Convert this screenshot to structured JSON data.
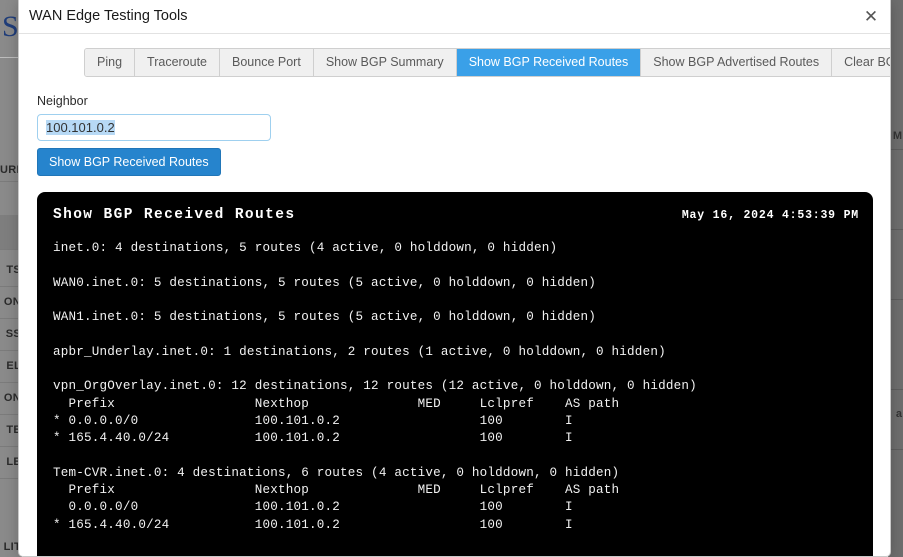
{
  "background": {
    "logo_glyph": "S",
    "sidebar_items": [
      {
        "label": "URIT"
      },
      {
        "label": ""
      },
      {
        "label": "TS"
      },
      {
        "label": "ON"
      },
      {
        "label": "SS"
      },
      {
        "label": "EL"
      },
      {
        "label": "ON"
      },
      {
        "label": "TE"
      },
      {
        "label": "LE"
      },
      {
        "label": "LIT"
      }
    ],
    "right_labels": [
      {
        "label": "M"
      },
      {
        "label": "a"
      }
    ]
  },
  "modal": {
    "title": "WAN Edge Testing Tools",
    "close_icon": "close-icon",
    "close_glyph": "✕",
    "accent_color": "#3aa0e8",
    "button_color": "#2684cd",
    "tabs": [
      {
        "label": "Ping",
        "active": false
      },
      {
        "label": "Traceroute",
        "active": false
      },
      {
        "label": "Bounce Port",
        "active": false
      },
      {
        "label": "Show BGP Summary",
        "active": false
      },
      {
        "label": "Show BGP Received Routes",
        "active": true
      },
      {
        "label": "Show BGP Advertised Routes",
        "active": false
      },
      {
        "label": "Clear BGP",
        "active": false
      }
    ],
    "form": {
      "neighbor_label": "Neighbor",
      "neighbor_value": "100.101.0.2",
      "neighbor_placeholder": "",
      "submit_label": "Show BGP Received Routes"
    },
    "terminal": {
      "title": "Show BGP Received Routes",
      "timestamp": "May 16, 2024 4:53:39 PM",
      "output": "inet.0: 4 destinations, 5 routes (4 active, 0 holddown, 0 hidden)\n\nWAN0.inet.0: 5 destinations, 5 routes (5 active, 0 holddown, 0 hidden)\n\nWAN1.inet.0: 5 destinations, 5 routes (5 active, 0 holddown, 0 hidden)\n\napbr_Underlay.inet.0: 1 destinations, 2 routes (1 active, 0 holddown, 0 hidden)\n\nvpn_OrgOverlay.inet.0: 12 destinations, 12 routes (12 active, 0 holddown, 0 hidden)\n  Prefix                  Nexthop              MED     Lclpref    AS path\n* 0.0.0.0/0               100.101.0.2                  100        I\n* 165.4.40.0/24           100.101.0.2                  100        I\n\nTem-CVR.inet.0: 4 destinations, 6 routes (4 active, 0 holddown, 0 hidden)\n  Prefix                  Nexthop              MED     Lclpref    AS path\n  0.0.0.0/0               100.101.0.2                  100        I\n* 165.4.40.0/24           100.101.0.2                  100        I"
    }
  }
}
